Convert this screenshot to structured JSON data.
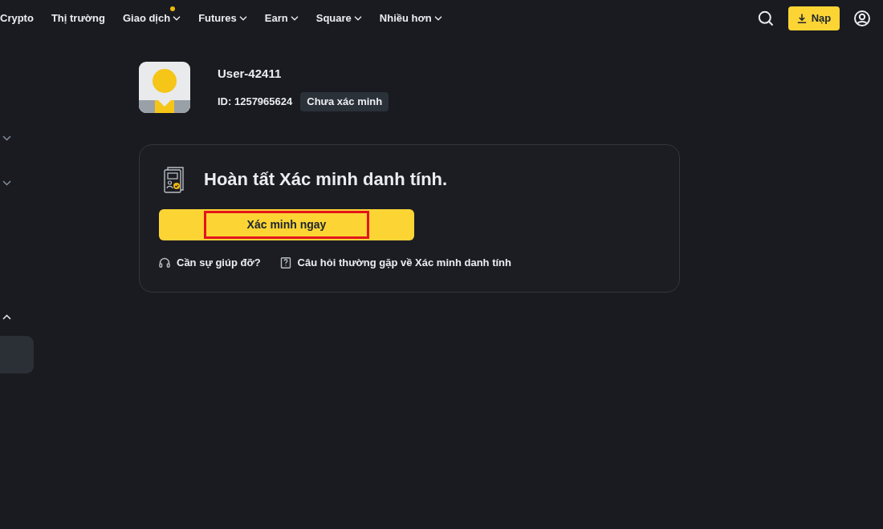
{
  "nav": {
    "items": [
      {
        "label": "Crypto",
        "dropdown": false,
        "dot": false
      },
      {
        "label": "Thị trường",
        "dropdown": false,
        "dot": false
      },
      {
        "label": "Giao dịch",
        "dropdown": true,
        "dot": true
      },
      {
        "label": "Futures",
        "dropdown": true,
        "dot": false
      },
      {
        "label": "Earn",
        "dropdown": true,
        "dot": false
      },
      {
        "label": "Square",
        "dropdown": true,
        "dot": false
      },
      {
        "label": "Nhiều hơn",
        "dropdown": true,
        "dot": false
      }
    ],
    "deposit_button": "Nạp"
  },
  "sidebar": {
    "groups": [
      {
        "expanded": false
      },
      {
        "expanded": false
      },
      {
        "expanded": true,
        "items": [
          {
            "selected": true
          }
        ]
      }
    ]
  },
  "profile": {
    "username": "User-42411",
    "id": "ID: 1257965624",
    "status_badge": "Chưa xác minh"
  },
  "verification_card": {
    "title": "Hoàn tất Xác minh danh tính.",
    "button": {
      "label": "Xác minh ngay",
      "highlighted": true
    },
    "links": [
      {
        "kind": "help",
        "label": "Cần sự giúp đỡ?"
      },
      {
        "kind": "faq",
        "label": "Câu hỏi thường gặp về Xác minh danh tính"
      }
    ]
  }
}
